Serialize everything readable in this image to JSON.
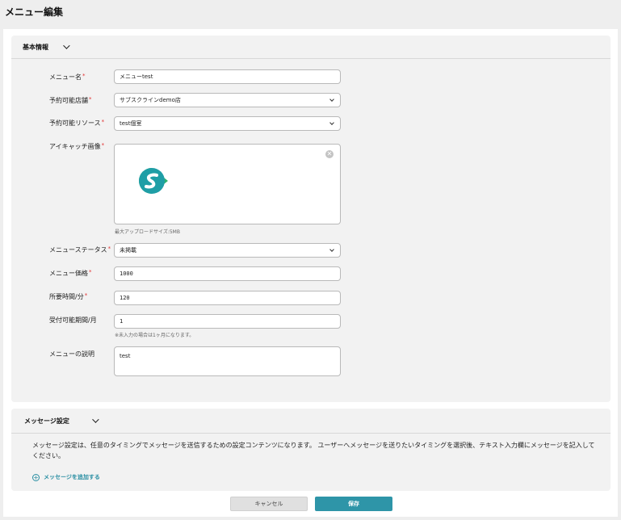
{
  "page": {
    "title": "メニュー編集"
  },
  "basic": {
    "title": "基本情報",
    "fields": {
      "menu_name": {
        "label": "メニュー名",
        "required": "*",
        "value": "メニューtest"
      },
      "store": {
        "label": "予約可能店舗",
        "required": "*",
        "value": "サブスクラインdemo店"
      },
      "resource": {
        "label": "予約可能リソース",
        "required": "*",
        "value": "test個室"
      },
      "eyecatch": {
        "label": "アイキャッチ画像",
        "required": "*",
        "hint": "最大アップロードサイズ:5MB"
      },
      "status": {
        "label": "メニューステータス",
        "required": "*",
        "value": "未掲載"
      },
      "price": {
        "label": "メニュー価格",
        "required": "*",
        "value": "1000"
      },
      "duration": {
        "label": "所要時間/分",
        "required": "*",
        "value": "120"
      },
      "period": {
        "label": "受付可能期間/月",
        "value": "1",
        "hint": "※未入力の場合は1ヶ月になります。"
      },
      "description": {
        "label": "メニューの説明",
        "value": "test"
      }
    }
  },
  "message": {
    "title": "メッセージ設定",
    "description": "メッセージ設定は、任意のタイミングでメッセージを送信するための設定コンテンツになります。 ユーザーへメッセージを送りたいタイミングを選択後、テキスト入力欄にメッセージを記入してください。",
    "add_label": "メッセージを追加する"
  },
  "actions": {
    "cancel": "キャンセル",
    "save": "保存"
  },
  "colors": {
    "accent": "#2e95a8",
    "required": "#e03030",
    "logo_green": "#2db36f",
    "logo_teal": "#1f9ea6"
  },
  "icons": [
    "chevron-down-icon",
    "close-icon",
    "plus-circle-icon",
    "logo-icon"
  ]
}
